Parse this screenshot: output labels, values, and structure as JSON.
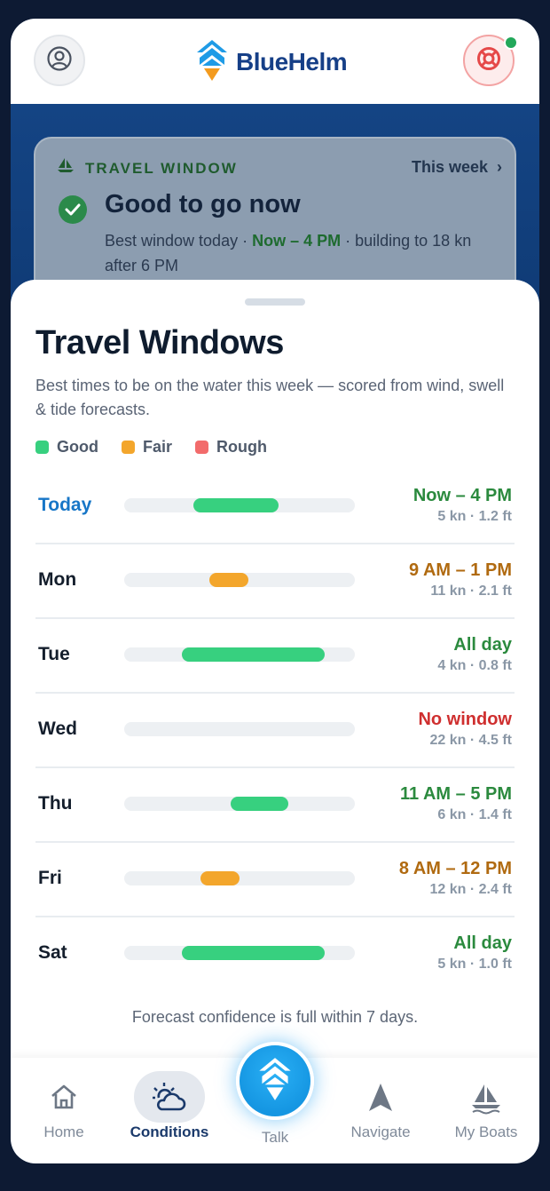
{
  "header": {
    "brand": "BlueHelm",
    "icons": {
      "profile": "user-circle-icon",
      "sos": "lifebuoy-icon"
    },
    "colors": {
      "brand": "#163f87",
      "notification": "#22a85a"
    }
  },
  "travel_card": {
    "label": "TRAVEL WINDOW",
    "week_link": "This week",
    "title": "Good to go now",
    "sub_prefix": "Best window today · ",
    "sub_highlight": "Now – 4 PM",
    "sub_suffix": " · building to 18 kn after 6 PM"
  },
  "sheet": {
    "title": "Travel Windows",
    "description": "Best times to be on the water this week — scored from wind, swell & tide forecasts.",
    "legend": [
      {
        "label": "Good",
        "color": "#37d07f"
      },
      {
        "label": "Fair",
        "color": "#f3a62c"
      },
      {
        "label": "Rough",
        "color": "#f26b6b"
      }
    ],
    "days": [
      {
        "day": "Today",
        "window": "Now – 4 PM",
        "conditions": "5 kn · 1.2 ft",
        "rating": "good",
        "start": 0.3,
        "end": 0.67,
        "today": true
      },
      {
        "day": "Mon",
        "window": "9 AM – 1 PM",
        "conditions": "11 kn · 2.1 ft",
        "rating": "fair",
        "start": 0.37,
        "end": 0.54
      },
      {
        "day": "Tue",
        "window": "All day",
        "conditions": "4 kn · 0.8 ft",
        "rating": "good",
        "start": 0.25,
        "end": 0.87
      },
      {
        "day": "Wed",
        "window": "No window",
        "conditions": "22 kn · 4.5 ft",
        "rating": "none",
        "start": null,
        "end": null
      },
      {
        "day": "Thu",
        "window": "11 AM – 5 PM",
        "conditions": "6 kn · 1.4 ft",
        "rating": "good",
        "start": 0.46,
        "end": 0.71
      },
      {
        "day": "Fri",
        "window": "8 AM – 12 PM",
        "conditions": "12 kn · 2.4 ft",
        "rating": "fair",
        "start": 0.33,
        "end": 0.5
      },
      {
        "day": "Sat",
        "window": "All day",
        "conditions": "5 kn · 1.0 ft",
        "rating": "good",
        "start": 0.25,
        "end": 0.87
      }
    ],
    "rating_colors": {
      "good": "#37d07f",
      "fair": "#f3a62c",
      "none": "#cfd6de"
    },
    "window_text_colors": {
      "good": "#2b8a3e",
      "fair": "#b06a10",
      "none": "#cf2f2f"
    },
    "footer_note": "Forecast confidence is full within 7 days."
  },
  "nav": {
    "items": [
      {
        "label": "Home",
        "icon": "home-icon"
      },
      {
        "label": "Conditions",
        "icon": "sun-cloud-icon",
        "active": true
      },
      {
        "label": "Talk",
        "icon": "helm-logo-icon"
      },
      {
        "label": "Navigate",
        "icon": "navigation-arrow-icon"
      },
      {
        "label": "My Boats",
        "icon": "sailboat-icon"
      }
    ]
  }
}
